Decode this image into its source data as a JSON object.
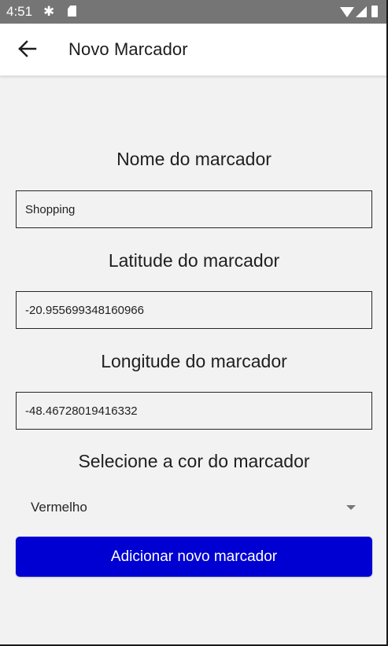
{
  "status_bar": {
    "time": "4:51",
    "icons": [
      "settings-gear-icon",
      "sd-card-icon",
      "wifi-icon",
      "signal-icon",
      "battery-icon"
    ]
  },
  "app_bar": {
    "back_icon": "arrow-left-icon",
    "title": "Novo Marcador"
  },
  "form": {
    "name": {
      "label": "Nome do marcador",
      "value": "Shopping"
    },
    "latitude": {
      "label": "Latitude do marcador",
      "value": "-20.955699348160966"
    },
    "longitude": {
      "label": "Longitude do marcador",
      "value": "-48.46728019416332"
    },
    "color": {
      "label": "Selecione a cor do marcador",
      "selected": "Vermelho",
      "icon": "chevron-down-icon"
    },
    "submit_label": "Adicionar novo marcador"
  },
  "colors": {
    "status_bar": "#757575",
    "app_bar": "#ffffff",
    "background": "#f2f2f2",
    "button": "#0000d2",
    "button_text": "#ffffff"
  }
}
